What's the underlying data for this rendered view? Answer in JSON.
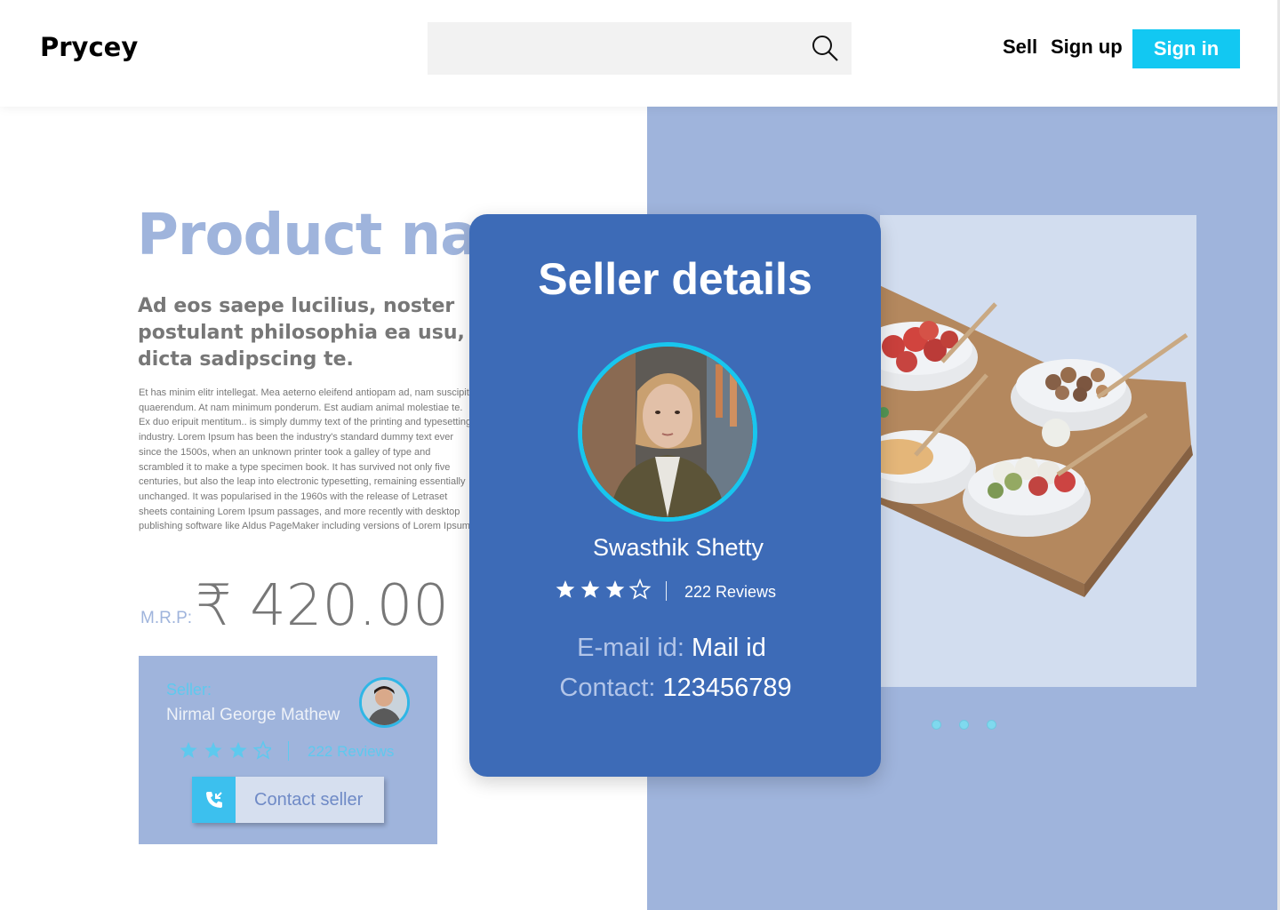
{
  "header": {
    "logo": "Prycey",
    "search": {
      "placeholder": ""
    },
    "nav": {
      "sell": "Sell",
      "sign_up": "Sign up",
      "sign_in": "Sign in"
    },
    "colors": {
      "sign_in_bg": "#12c8f2",
      "search_bg": "#f2f2f2"
    }
  },
  "product": {
    "title": "Product name",
    "subtitle": "Ad eos saepe lucilius, noster postulant philosophia ea usu, dicta sadipscing te.",
    "description": "Et has minim elitr intellegat. Mea aeterno eleifend antiopam ad, nam suscipit quaerendum. At nam minimum ponderum. Est audiam animal molestiae te. Ex duo eripuit mentitum.. is simply dummy text of the printing and typesetting industry. Lorem Ipsum has been the industry's standard dummy text ever since the 1500s, when an unknown printer took a galley of type and scrambled it to make a type specimen book. It has survived not only five centuries, but also the leap into electronic typesetting, remaining essentially unchanged. It was popularised in the 1960s with the release of Letraset sheets containing Lorem Ipsum passages, and more recently with desktop publishing software like Aldus PageMaker including versions of Lorem Ipsum.",
    "mrp_label": "M.R.P:",
    "price": "₹ 420.00",
    "image_icon": "food-bowls-image",
    "carousel": {
      "slides": 3,
      "active_index": 0
    }
  },
  "seller_card": {
    "label": "Seller:",
    "name": "Nirmal George Mathew",
    "rating": 3.5,
    "rating_max": 5,
    "reviews": "222 Reviews",
    "contact_button": "Contact seller",
    "contact_icon": "phone-incoming-icon"
  },
  "seller_details": {
    "title": "Seller details",
    "name": "Swasthik Shetty",
    "rating": 3.5,
    "rating_max": 5,
    "reviews": "222 Reviews",
    "email_label": "E-mail id:",
    "email_value": "Mail id",
    "contact_label": "Contact:",
    "contact_value": "123456789"
  },
  "colors": {
    "accent_cyan": "#12c8f2",
    "panel_blue": "#9fb4dc",
    "modal_blue": "#3d6bb7",
    "star_cyan": "#5ec9ee"
  }
}
